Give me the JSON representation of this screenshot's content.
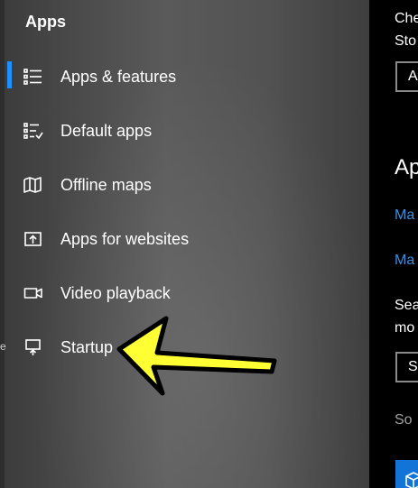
{
  "sidebar": {
    "heading": "Apps",
    "items": [
      {
        "label": "Apps & features",
        "icon": "apps-features-icon",
        "active": true
      },
      {
        "label": "Default apps",
        "icon": "default-apps-icon",
        "active": false
      },
      {
        "label": "Offline maps",
        "icon": "offline-maps-icon",
        "active": false
      },
      {
        "label": "Apps for websites",
        "icon": "apps-for-websites-icon",
        "active": false
      },
      {
        "label": "Video playback",
        "icon": "video-playback-icon",
        "active": false
      },
      {
        "label": "Startup",
        "icon": "startup-icon",
        "active": false
      }
    ],
    "left_edge_mark": "e"
  },
  "annotation": {
    "arrow_color": "#ffff33",
    "outline_color": "#000000",
    "points_to": "Startup"
  },
  "right_pane": {
    "lines": [
      {
        "text": "Che",
        "style": "normal"
      },
      {
        "text": "Sto",
        "style": "normal"
      },
      {
        "text": "A",
        "style": "button"
      },
      {
        "text": "Ap",
        "style": "big"
      },
      {
        "text": "Ma",
        "style": "link"
      },
      {
        "text": "Ma",
        "style": "link"
      },
      {
        "text": "Sea",
        "style": "normal"
      },
      {
        "text": "mo",
        "style": "normal"
      },
      {
        "text": "S",
        "style": "input"
      },
      {
        "text": "So",
        "style": "muted"
      }
    ]
  },
  "colors": {
    "accent": "#1e90ff",
    "link": "#3a8fe0",
    "tile": "#1374d8"
  }
}
